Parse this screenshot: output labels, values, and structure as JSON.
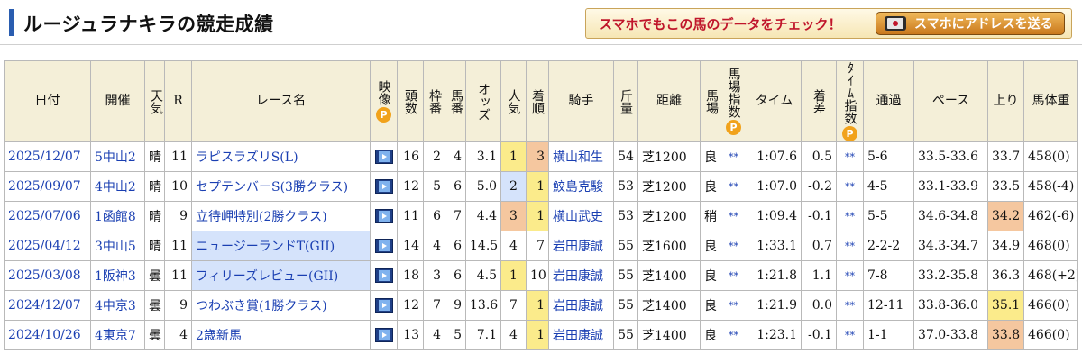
{
  "header": {
    "title": "ルージュラナキラの競走成績",
    "promo_text": "スマホでもこの馬のデータをチェック！",
    "promo_button": "スマホにアドレスを送る"
  },
  "table": {
    "headers": {
      "date": "日付",
      "venue": "開催",
      "weather": "天気",
      "race_no": "R",
      "race_name": "レース名",
      "video": "映像",
      "runners": "頭数",
      "frame": "枠番",
      "horse_no": "馬番",
      "odds": "オッズ",
      "popularity": "人気",
      "finish": "着順",
      "jockey": "騎手",
      "weight": "斤量",
      "distance": "距離",
      "track": "馬場",
      "track_index": "馬場指数",
      "time": "タイム",
      "margin": "着差",
      "time_index": "ﾀｲﾑ指数",
      "passing": "通過",
      "pace": "ペース",
      "last3f": "上り",
      "body_weight": "馬体重",
      "p_badge": "P"
    },
    "rows": [
      {
        "date": "2025/12/07",
        "venue": "5中山2",
        "weather": "晴",
        "race_no": "11",
        "race_name": "ラピスラズリS(L)",
        "graded": false,
        "runners": "16",
        "frame": "2",
        "horse_no": "4",
        "odds": "3.1",
        "popularity": "1",
        "finish": "3",
        "jockey": "横山和生",
        "weight": "54",
        "distance": "芝1200",
        "track": "良",
        "track_index": "**",
        "time": "1:07.6",
        "margin": "0.5",
        "time_index": "**",
        "passing": "5-6",
        "pace": "33.5-33.6",
        "last3f": "33.7",
        "body_weight": "458(0)"
      },
      {
        "date": "2025/09/07",
        "venue": "4中山2",
        "weather": "晴",
        "race_no": "10",
        "race_name": "セプテンバーS(3勝クラス)",
        "graded": false,
        "runners": "12",
        "frame": "5",
        "horse_no": "6",
        "odds": "5.0",
        "popularity": "2",
        "finish": "1",
        "jockey": "鮫島克駿",
        "weight": "53",
        "distance": "芝1200",
        "track": "良",
        "track_index": "**",
        "time": "1:07.0",
        "margin": "-0.2",
        "time_index": "**",
        "passing": "4-5",
        "pace": "33.1-33.9",
        "last3f": "33.5",
        "body_weight": "458(-4)"
      },
      {
        "date": "2025/07/06",
        "venue": "1函館8",
        "weather": "晴",
        "race_no": "9",
        "race_name": "立待岬特別(2勝クラス)",
        "graded": false,
        "runners": "11",
        "frame": "6",
        "horse_no": "7",
        "odds": "4.4",
        "popularity": "3",
        "finish": "1",
        "jockey": "横山武史",
        "weight": "53",
        "distance": "芝1200",
        "track": "稍",
        "track_index": "**",
        "time": "1:09.4",
        "margin": "-0.1",
        "time_index": "**",
        "passing": "5-5",
        "pace": "34.6-34.8",
        "last3f": "34.2",
        "body_weight": "462(-6)"
      },
      {
        "date": "2025/04/12",
        "venue": "3中山5",
        "weather": "晴",
        "race_no": "11",
        "race_name": "ニュージーランドT(GII)",
        "graded": true,
        "runners": "14",
        "frame": "4",
        "horse_no": "6",
        "odds": "14.5",
        "popularity": "4",
        "finish": "7",
        "jockey": "岩田康誠",
        "weight": "55",
        "distance": "芝1600",
        "track": "良",
        "track_index": "**",
        "time": "1:33.1",
        "margin": "0.7",
        "time_index": "**",
        "passing": "2-2-2",
        "pace": "34.3-34.7",
        "last3f": "34.9",
        "body_weight": "468(0)"
      },
      {
        "date": "2025/03/08",
        "venue": "1阪神3",
        "weather": "曇",
        "race_no": "11",
        "race_name": "フィリーズレビュー(GII)",
        "graded": true,
        "runners": "18",
        "frame": "3",
        "horse_no": "6",
        "odds": "4.5",
        "popularity": "1",
        "finish": "10",
        "jockey": "岩田康誠",
        "weight": "55",
        "distance": "芝1400",
        "track": "良",
        "track_index": "**",
        "time": "1:21.8",
        "margin": "1.1",
        "time_index": "**",
        "passing": "7-8",
        "pace": "33.2-35.8",
        "last3f": "36.3",
        "body_weight": "468(+2)"
      },
      {
        "date": "2024/12/07",
        "venue": "4中京3",
        "weather": "曇",
        "race_no": "9",
        "race_name": "つわぶき賞(1勝クラス)",
        "graded": false,
        "runners": "12",
        "frame": "7",
        "horse_no": "9",
        "odds": "13.6",
        "popularity": "7",
        "finish": "1",
        "jockey": "岩田康誠",
        "weight": "55",
        "distance": "芝1400",
        "track": "良",
        "track_index": "**",
        "time": "1:21.9",
        "margin": "0.0",
        "time_index": "**",
        "passing": "12-11",
        "pace": "33.8-36.0",
        "last3f": "35.1",
        "body_weight": "466(0)"
      },
      {
        "date": "2024/10/26",
        "venue": "4東京7",
        "weather": "曇",
        "race_no": "4",
        "race_name": "2歳新馬",
        "graded": false,
        "runners": "13",
        "frame": "4",
        "horse_no": "5",
        "odds": "7.1",
        "popularity": "4",
        "finish": "1",
        "jockey": "岩田康誠",
        "weight": "55",
        "distance": "芝1400",
        "track": "良",
        "track_index": "**",
        "time": "1:23.1",
        "margin": "-0.1",
        "time_index": "**",
        "passing": "1-1",
        "pace": "37.0-33.8",
        "last3f": "33.8",
        "body_weight": "466(0)"
      }
    ]
  },
  "colors": {
    "header_bg": "#f4efd8",
    "link": "#1a3fb2",
    "popularity_1": "#fbeb8b",
    "popularity_2": "#d5e3fb",
    "popularity_3": "#f5c79f",
    "graded_race_bg": "#d5e3fb",
    "accent_bar": "#2a5db0",
    "promo_text": "#c0162b"
  },
  "icons": {
    "video": "video-play-icon",
    "phone": "smartphone-icon",
    "p_badge": "premium-p-badge-icon"
  }
}
